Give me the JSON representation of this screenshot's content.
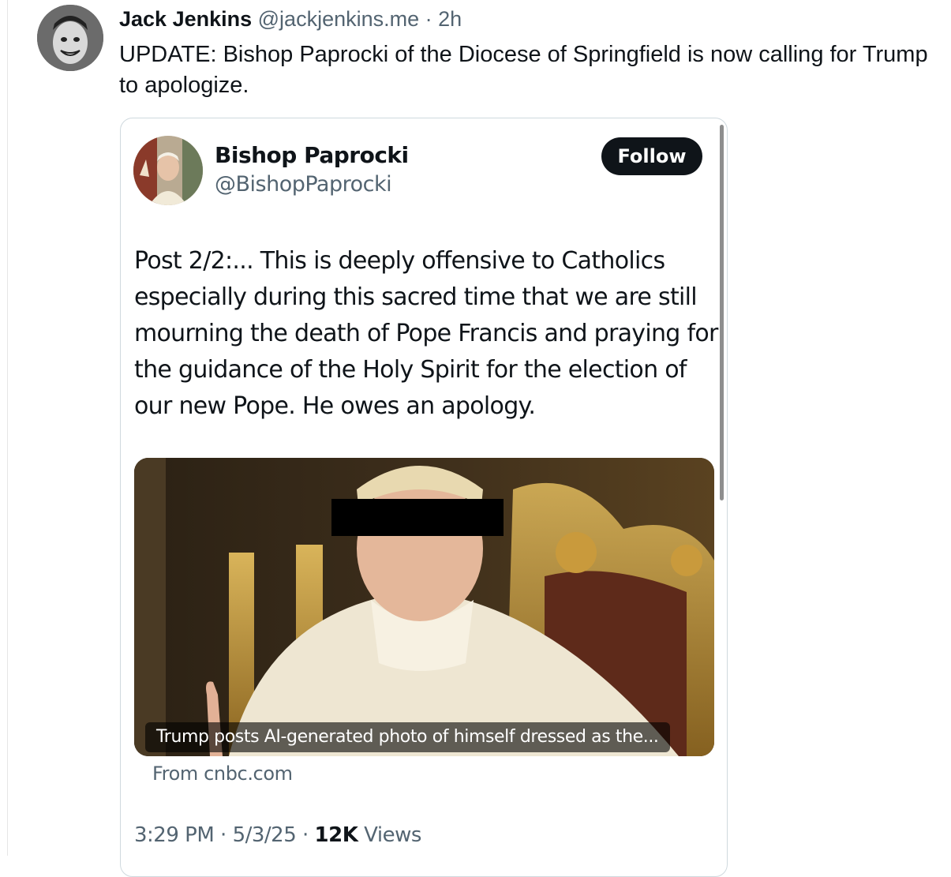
{
  "post": {
    "author_name": "Jack Jenkins",
    "author_handle": "@jackjenkins.me",
    "separator": "·",
    "time": "2h",
    "text": "UPDATE: Bishop Paprocki of the Diocese of Springfield is now calling for Trump to apologize."
  },
  "quoted_post": {
    "author_name": "Bishop Paprocki",
    "author_handle": "@BishopPaprocki",
    "follow_label": "Follow",
    "text": "Post 2/2:... This is deeply offensive to Catholics especially during this sacred time that we are still mourning the death of Pope Francis and praying for the guidance of the Holy Spirit for the election of our new Pope. He owes an apology.",
    "media_caption": "Trump posts AI-generated photo of himself dressed as the...",
    "source": "From cnbc.com",
    "time": "3:29 PM",
    "separator": "·",
    "date": "5/3/25",
    "views_count": "12K",
    "views_label": "Views"
  },
  "colors": {
    "text_primary": "#0f1419",
    "text_secondary": "#536471",
    "border": "#cfd9de",
    "follow_bg": "#0f1419"
  }
}
